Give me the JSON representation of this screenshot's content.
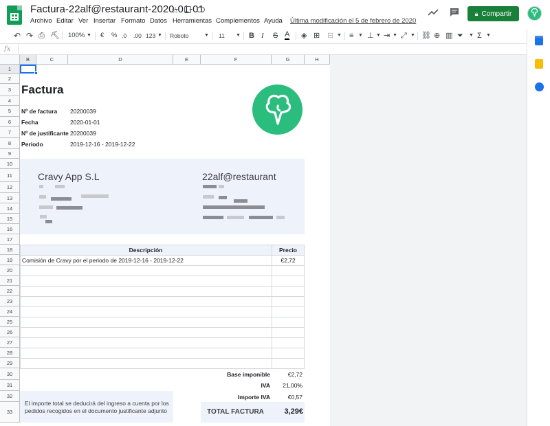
{
  "app": {
    "title": "Factura-22alf@restaurant-2020-01-01",
    "menus": [
      "Archivo",
      "Editar",
      "Ver",
      "Insertar",
      "Formato",
      "Datos",
      "Herramientas",
      "Complementos",
      "Ayuda"
    ],
    "last_edit": "Última modificación el 5 de febrero de 2020",
    "share_label": "Compartir"
  },
  "toolbar": {
    "zoom": "100%",
    "currency": "€",
    "percent": "%",
    "dec_less": ".0",
    "dec_more": ".00",
    "format_more": "123",
    "font": "Roboto",
    "font_size": "11",
    "bold": "B",
    "italic": "I",
    "strike": "S",
    "textcolor": "A",
    "sum": "Σ"
  },
  "formula": {
    "fx": "fx"
  },
  "columns": [
    "B",
    "C",
    "D",
    "E",
    "F",
    "G",
    "H"
  ],
  "rows": [
    "1",
    "2",
    "3",
    "4",
    "5",
    "6",
    "7",
    "8",
    "9",
    "10",
    "11",
    "12",
    "13",
    "14",
    "15",
    "16",
    "17",
    "18",
    "19",
    "20",
    "21",
    "22",
    "23",
    "24",
    "25",
    "26",
    "27",
    "28",
    "29",
    "30",
    "31",
    "32",
    "33"
  ],
  "invoice": {
    "heading": "Factura",
    "fields": [
      {
        "label": "Nº de factura",
        "value": "20200039"
      },
      {
        "label": "Fecha",
        "value": "2020-01-01"
      },
      {
        "label": "Nº de justificante",
        "value": "20200039"
      },
      {
        "label": "Periodo",
        "value": "2019-12-16 - 2019-12-22"
      }
    ],
    "from": "Cravy App S.L",
    "to": "22alf@restaurant",
    "table_headers": [
      "Descripción",
      "Precio"
    ],
    "items": [
      {
        "desc": "Comisión de Cravy por el periodo de 2019-12-16 - 2019-12-22",
        "price": "€2,72"
      }
    ],
    "totals": [
      {
        "label": "Base imponible",
        "value": "€2,72"
      },
      {
        "label": "IVA",
        "value": "21,00%"
      },
      {
        "label": "Importe IVA",
        "value": "€0,57"
      }
    ],
    "total_label": "TOTAL FACTURA",
    "total_value": "3,29€",
    "note": "El importe total se deducirá del ingreso a cuenta por los pedidos recogidos en el documento justificante adjunto"
  },
  "colors": {
    "brand": "#2bbd7e",
    "share": "#188038",
    "panel": "#eef2fa"
  }
}
